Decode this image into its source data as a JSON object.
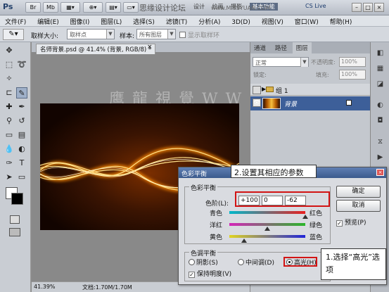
{
  "titlebar": {
    "app_logo": "Ps",
    "watermark_left": "思缘设计论坛",
    "watermark_right": "www.MISSYUAN.COM",
    "workspace_tabs": [
      "设计",
      "绘画",
      "摄影"
    ],
    "active_workspace": "基本功能",
    "cs_live": "CS Live"
  },
  "menu": [
    "文件(F)",
    "编辑(E)",
    "图像(I)",
    "图层(L)",
    "选择(S)",
    "滤镜(T)",
    "分析(A)",
    "3D(D)",
    "视图(V)",
    "窗口(W)",
    "帮助(H)"
  ],
  "options": {
    "sample_size_label": "取样大小:",
    "sample_size_value": "取样点",
    "sample_label": "样本:",
    "sample_value": "所有图层",
    "show_ring_label": "显示取样环"
  },
  "document": {
    "tab_title": "名师背景.psd @ 41.4% (背景, RGB/8) *",
    "close": "×",
    "zoom": "41.39%",
    "doc_size": "文档:1.70M/1.70M",
    "watermark": "鹰 龍 視 覺  W W W . · · · N E T"
  },
  "layers_panel": {
    "tabs": [
      "通道",
      "路径",
      "图层"
    ],
    "blend_mode": "正常",
    "opacity_label": "不透明度:",
    "opacity_value": "100%",
    "lock_label": "锁定:",
    "fill_label": "填充:",
    "fill_value": "100%",
    "layers": [
      {
        "name": "组 1",
        "type": "group",
        "visible": false,
        "expanded": false
      },
      {
        "name": "背景",
        "type": "background",
        "visible": true,
        "locked": true,
        "selected": true
      }
    ]
  },
  "dialog": {
    "title": "色彩平衡",
    "color_balance_legend": "色彩平衡",
    "levels_label": "色阶(L):",
    "levels": [
      "+100",
      "0",
      "-62"
    ],
    "sliders": [
      {
        "left": "青色",
        "right": "红色",
        "value": 100,
        "colors": [
          "#00b7c9",
          "#e82020"
        ]
      },
      {
        "left": "洋红",
        "right": "绿色",
        "value": 0,
        "colors": [
          "#d425b8",
          "#2ab62a"
        ]
      },
      {
        "left": "黄色",
        "right": "蓝色",
        "value": -62,
        "colors": [
          "#e0d420",
          "#2024d8"
        ]
      }
    ],
    "tone_legend": "色调平衡",
    "tone_options": [
      "阴影(S)",
      "中间调(D)",
      "高光(H)"
    ],
    "tone_selected": "高光(H)",
    "preserve_label": "保持明度(V)",
    "preserve_checked": true,
    "ok": "确定",
    "cancel": "取消",
    "preview_label": "预览(P)",
    "preview_checked": true
  },
  "callouts": {
    "step2": "2.设置其相应的参数",
    "step1": "1.选择“高光”选项"
  }
}
